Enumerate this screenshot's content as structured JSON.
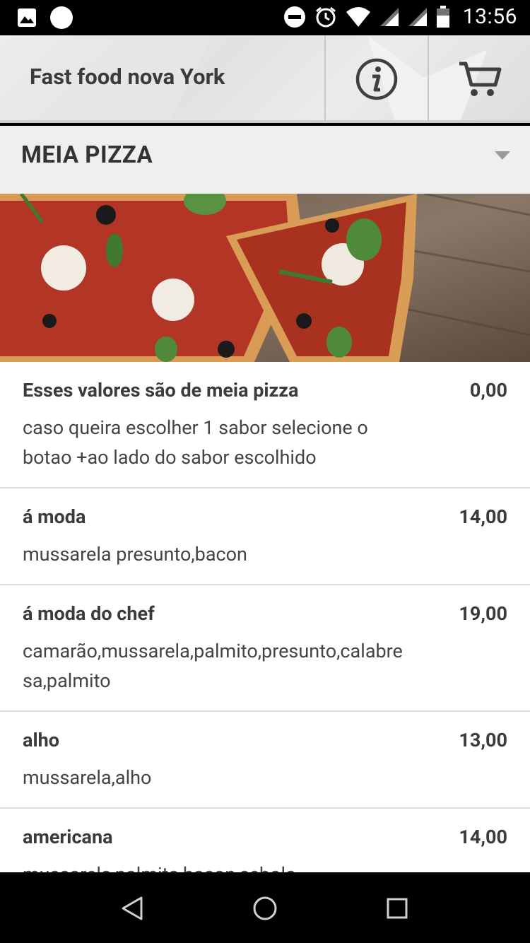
{
  "status_bar": {
    "time": "13:56",
    "icons": [
      "image-icon",
      "circle-icon",
      "do-not-disturb-icon",
      "alarm-icon",
      "wifi-icon",
      "signal-icon",
      "signal-icon",
      "battery-icon"
    ]
  },
  "app_bar": {
    "title": "Fast food nova York",
    "info_icon": "info-icon",
    "cart_icon": "cart-icon"
  },
  "category": {
    "title": "MEIA PIZZA",
    "dropdown_icon": "caret-down-icon"
  },
  "items": [
    {
      "name": "Esses valores são de meia pizza",
      "price": "0,00",
      "desc_lines": [
        "caso queira escolher 1 sabor selecione o",
        "botao +ao lado do sabor escolhido"
      ]
    },
    {
      "name": "á moda",
      "price": "14,00",
      "desc_lines": [
        "mussarela presunto,bacon"
      ]
    },
    {
      "name": "á moda do chef",
      "price": "19,00",
      "desc_lines": [
        "camarão,mussarela,palmito,presunto,calabre",
        "sa,palmito"
      ]
    },
    {
      "name": "alho",
      "price": "13,00",
      "desc_lines": [
        "mussarela,alho"
      ]
    },
    {
      "name": "americana",
      "price": "14,00",
      "desc_lines": [
        "mussarela,palmito,bacon,cebola"
      ]
    }
  ],
  "nav_bar": {
    "icons": [
      "back-icon",
      "home-icon",
      "recents-icon"
    ]
  },
  "colors": {
    "text_dark": "#3b3b3b",
    "header_bg": "#efefef",
    "divider": "#dcdcdc"
  }
}
